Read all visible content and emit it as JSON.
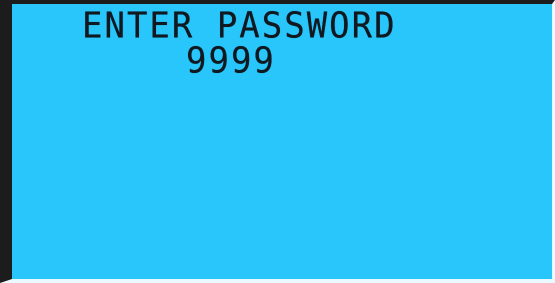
{
  "display": {
    "background_color": "#29c6fb",
    "text_color": "#101820",
    "prompt_text": "ENTER PASSWORD",
    "password_value": "9999"
  }
}
